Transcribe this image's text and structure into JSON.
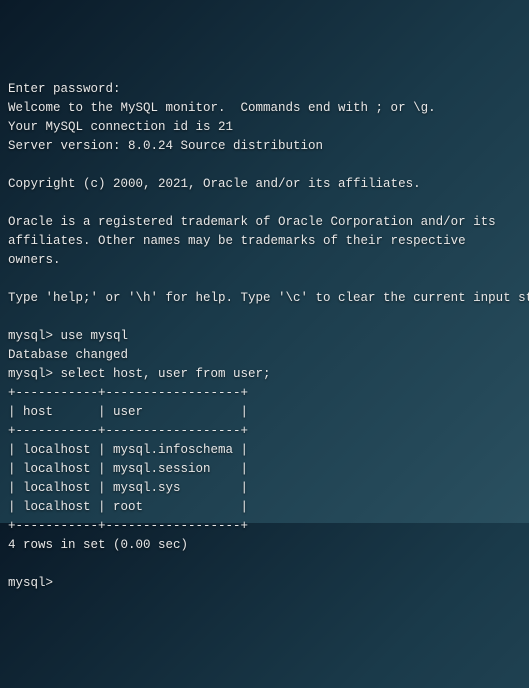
{
  "terminal": {
    "line1": "Enter password:",
    "line2": "Welcome to the MySQL monitor.  Commands end with ; or \\g.",
    "line3": "Your MySQL connection id is 21",
    "line4": "Server version: 8.0.24 Source distribution",
    "line5": "",
    "line6": "Copyright (c) 2000, 2021, Oracle and/or its affiliates.",
    "line7": "",
    "line8": "Oracle is a registered trademark of Oracle Corporation and/or its",
    "line9": "affiliates. Other names may be trademarks of their respective",
    "line10": "owners.",
    "line11": "",
    "line12": "Type 'help;' or '\\h' for help. Type '\\c' to clear the current input statement.",
    "line13": "",
    "line14": "mysql> use mysql",
    "line15": "Database changed",
    "line16": "mysql> select host, user from user;",
    "line17": "+-----------+------------------+",
    "line18": "| host      | user             |",
    "line19": "+-----------+------------------+",
    "line20": "| localhost | mysql.infoschema |",
    "line21": "| localhost | mysql.session    |",
    "line22": "| localhost | mysql.sys        |",
    "line23": "| localhost | root             |",
    "line24": "+-----------+------------------+",
    "line25": "4 rows in set (0.00 sec)",
    "line26": "",
    "line27": "mysql> "
  }
}
